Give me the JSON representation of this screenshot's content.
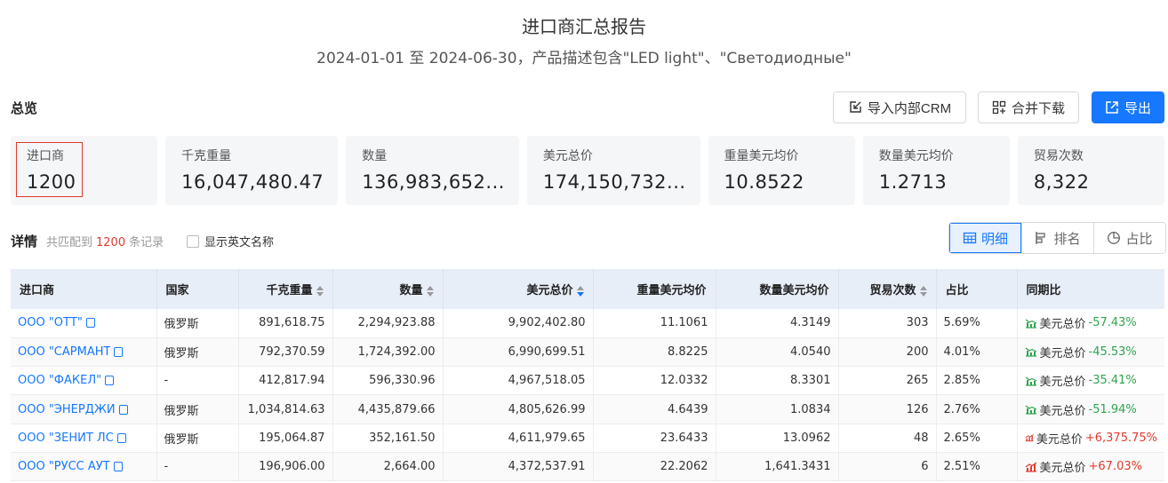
{
  "report": {
    "title": "进口商汇总报告",
    "subtitle": "2024-01-01 至 2024-06-30，产品描述包含\"LED light\"、\"Светодиодные\""
  },
  "overview": {
    "label": "总览",
    "buttons": {
      "crm": "导入内部CRM",
      "merge": "合并下载",
      "export": "导出"
    },
    "cards": [
      {
        "label": "进口商",
        "value": "1200"
      },
      {
        "label": "千克重量",
        "value": "16,047,480.47"
      },
      {
        "label": "数量",
        "value": "136,983,652..."
      },
      {
        "label": "美元总价",
        "value": "174,150,732..."
      },
      {
        "label": "重量美元均价",
        "value": "10.8522"
      },
      {
        "label": "数量美元均价",
        "value": "1.2713"
      },
      {
        "label": "贸易次数",
        "value": "8,322"
      }
    ]
  },
  "detail": {
    "label": "详情",
    "prefix": "共匹配到",
    "count": "1200",
    "suffix": "条记录",
    "checkbox_label": "显示英文名称",
    "views": [
      "明细",
      "排名",
      "占比"
    ],
    "active_view": "明细",
    "colors": {
      "accent": "#1677ff",
      "down": "#2ea44f",
      "up": "#e03a2f"
    }
  },
  "table": {
    "headers": [
      "进口商",
      "国家",
      "千克重量",
      "数量",
      "美元总价",
      "重量美元均价",
      "数量美元均价",
      "贸易次数",
      "占比",
      "同期比"
    ],
    "rows": [
      {
        "importer": "ООО \"ОТТ\"",
        "country": "俄罗斯",
        "kg": "891,618.75",
        "qty": "2,294,923.88",
        "usd": "9,902,402.80",
        "kg_avg": "11.1061",
        "qty_avg": "4.3149",
        "trades": "303",
        "share": "5.69%",
        "yoy_label": "美元总价",
        "yoy": "-57.43%",
        "trend": "down"
      },
      {
        "importer": "ООО \"САРМАНТ",
        "country": "俄罗斯",
        "kg": "792,370.59",
        "qty": "1,724,392.00",
        "usd": "6,990,699.51",
        "kg_avg": "8.8225",
        "qty_avg": "4.0540",
        "trades": "200",
        "share": "4.01%",
        "yoy_label": "美元总价",
        "yoy": "-45.53%",
        "trend": "down"
      },
      {
        "importer": "ООО \"ФАКЕЛ\"",
        "country": "-",
        "kg": "412,817.94",
        "qty": "596,330.96",
        "usd": "4,967,518.05",
        "kg_avg": "12.0332",
        "qty_avg": "8.3301",
        "trades": "265",
        "share": "2.85%",
        "yoy_label": "美元总价",
        "yoy": "-35.41%",
        "trend": "down"
      },
      {
        "importer": "ООО \"ЭНЕРДЖИ",
        "country": "俄罗斯",
        "kg": "1,034,814.63",
        "qty": "4,435,879.66",
        "usd": "4,805,626.99",
        "kg_avg": "4.6439",
        "qty_avg": "1.0834",
        "trades": "126",
        "share": "2.76%",
        "yoy_label": "美元总价",
        "yoy": "-51.94%",
        "trend": "down"
      },
      {
        "importer": "ООО \"ЗЕНИТ ЛС",
        "country": "俄罗斯",
        "kg": "195,064.87",
        "qty": "352,161.50",
        "usd": "4,611,979.65",
        "kg_avg": "23.6433",
        "qty_avg": "13.0962",
        "trades": "48",
        "share": "2.65%",
        "yoy_label": "美元总价",
        "yoy": "+6,375.75%",
        "trend": "up"
      },
      {
        "importer": "ООО \"РУСС АУТ",
        "country": "-",
        "kg": "196,906.00",
        "qty": "2,664.00",
        "usd": "4,372,537.91",
        "kg_avg": "22.2062",
        "qty_avg": "1,641.3431",
        "trades": "6",
        "share": "2.51%",
        "yoy_label": "美元总价",
        "yoy": "+67.03%",
        "trend": "up"
      }
    ]
  }
}
